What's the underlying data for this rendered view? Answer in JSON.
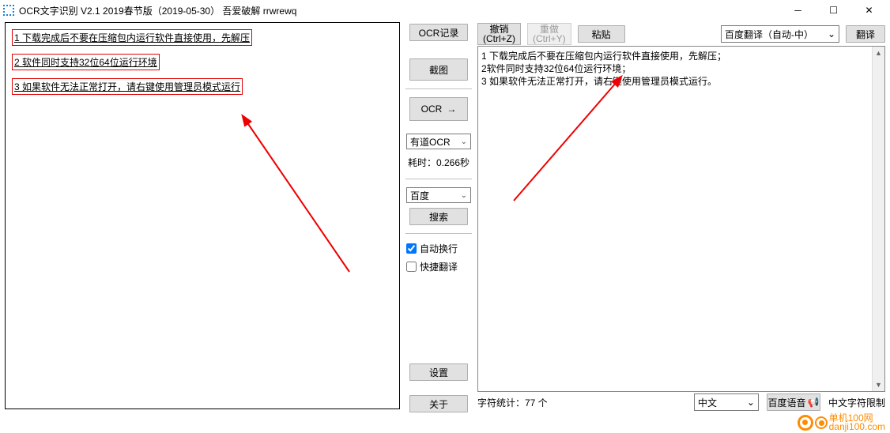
{
  "title": "OCR文字识别 V2.1   2019春节版（2019-05-30）  吾爱破解 rrwrewq",
  "left_lines": {
    "l1": "1 下载完成后不要在压缩包内运行软件直接使用，先解压",
    "l2": "2 软件同时支持32位64位运行环境",
    "l3": "3 如果软件无法正常打开，请右键使用管理员模式运行"
  },
  "mid": {
    "ocr_record": "OCR记录",
    "screenshot": "截图",
    "ocr": "OCR",
    "engine_sel": "有道OCR",
    "timing": "耗时：0.266秒",
    "baidu": "百度",
    "search": "搜索",
    "auto_wrap": "自动换行",
    "quick_trans": "快捷翻译",
    "settings": "设置",
    "about": "关于"
  },
  "top": {
    "undo_l1": "撤销",
    "undo_l2": "(Ctrl+Z)",
    "redo_l1": "重做",
    "redo_l2": "(Ctrl+Y)",
    "paste": "粘贴",
    "trans_sel": "百度翻译（自动-中）",
    "translate": "翻译"
  },
  "text_lines": {
    "t1": "1 下载完成后不要在压缩包内运行软件直接使用，先解压；",
    "t2": "2软件同时支持32位64位运行环境；",
    "t3": "3 如果软件无法正常打开，请右键使用管理员模式运行。"
  },
  "bottom": {
    "stats": "字符统计：77 个",
    "lang_sel": "中文",
    "voice": "百度语音",
    "limit_prefix": "中文字符限制"
  },
  "watermark": {
    "name": "单机100网",
    "url": "danji100.com"
  }
}
